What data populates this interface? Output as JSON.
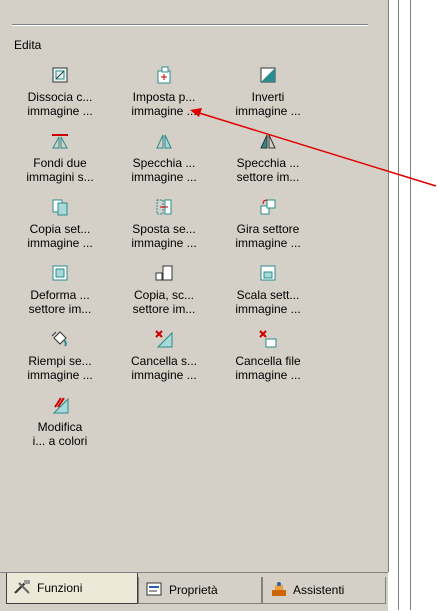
{
  "section_title": "Edita",
  "items": [
    {
      "line1": "Dissocia c...",
      "line2": "immagine ...",
      "icon": "dissociate-icon"
    },
    {
      "line1": "Imposta p...",
      "line2": "immagine ...",
      "icon": "set-point-icon"
    },
    {
      "line1": "Inverti",
      "line2": "immagine ...",
      "icon": "invert-icon"
    },
    {
      "line1": "Fondi due",
      "line2": "immagini s...",
      "icon": "merge-icon"
    },
    {
      "line1": "Specchia ...",
      "line2": "immagine ...",
      "icon": "mirror-image-icon"
    },
    {
      "line1": "Specchia ...",
      "line2": "settore im...",
      "icon": "mirror-sector-icon"
    },
    {
      "line1": "Copia set...",
      "line2": "immagine ...",
      "icon": "copy-sector-icon"
    },
    {
      "line1": "Sposta se...",
      "line2": "immagine ...",
      "icon": "move-sector-icon"
    },
    {
      "line1": "Gira settore",
      "line2": "immagine ...",
      "icon": "rotate-sector-icon"
    },
    {
      "line1": "Deforma ...",
      "line2": "settore im...",
      "icon": "deform-icon"
    },
    {
      "line1": "Copia, sc...",
      "line2": "settore im...",
      "icon": "copy-scale-icon"
    },
    {
      "line1": "Scala sett...",
      "line2": "immagine ...",
      "icon": "scale-sector-icon"
    },
    {
      "line1": "Riempi se...",
      "line2": "immagine ...",
      "icon": "fill-bucket-icon"
    },
    {
      "line1": "Cancella s...",
      "line2": "immagine ...",
      "icon": "delete-sector-icon"
    },
    {
      "line1": "Cancella file",
      "line2": "immagine ...",
      "icon": "delete-file-icon"
    },
    {
      "line1": "Modifica",
      "line2": "i... a colori",
      "icon": "edit-colors-icon"
    }
  ],
  "tabs": [
    {
      "label": "Funzioni",
      "icon": "tools-icon"
    },
    {
      "label": "Proprietà",
      "icon": "properties-icon"
    },
    {
      "label": "Assistenti",
      "icon": "assistants-icon"
    }
  ],
  "colors": {
    "panel": "#d4d0c8",
    "arrow": "#e00000",
    "accent": "#2a8c8c"
  }
}
